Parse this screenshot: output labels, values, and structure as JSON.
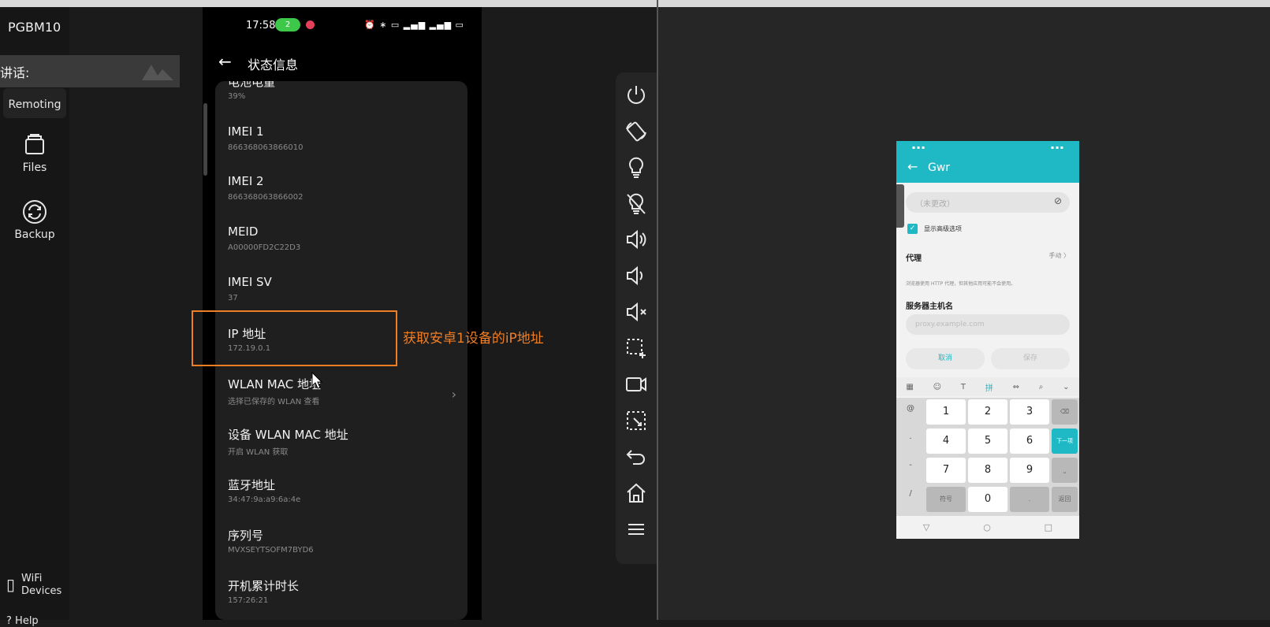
{
  "sidebar": {
    "app_title": "PGBM10",
    "talk_label": "讲话:",
    "items": [
      {
        "label": "Remoting"
      },
      {
        "label": "Files"
      },
      {
        "label": "Backup"
      }
    ],
    "wifi_label_1": "WiFi",
    "wifi_label_2": "Devices",
    "help_label": "Help"
  },
  "phone": {
    "status_time": "17:58",
    "status_pill": "2",
    "page_title": "状态信息",
    "rows": [
      {
        "title": "电池电量",
        "value": "39%"
      },
      {
        "title": "IMEI 1",
        "value": "866368063866010"
      },
      {
        "title": "IMEI 2",
        "value": "866368063866002"
      },
      {
        "title": "MEID",
        "value": "A00000FD2C22D3"
      },
      {
        "title": "IMEI SV",
        "value": "37"
      },
      {
        "title": "IP 地址",
        "value": "172.19.0.1"
      },
      {
        "title": "WLAN MAC 地址",
        "value": "选择已保存的 WLAN 查看"
      },
      {
        "title": "设备 WLAN MAC 地址",
        "value": "开启 WLAN 获取"
      },
      {
        "title": "蓝牙地址",
        "value": "34:47:9a:a9:6a:4e"
      },
      {
        "title": "序列号",
        "value": "MVXSEYTSOFM7BYD6"
      },
      {
        "title": "开机累计时长",
        "value": "157:26:21"
      }
    ]
  },
  "annotation": {
    "text": "获取安卓1设备的iP地址",
    "color": "#f07e25"
  },
  "controls": [
    {
      "icon": "power-icon"
    },
    {
      "icon": "rotate-icon"
    },
    {
      "icon": "light-bulb-icon"
    },
    {
      "icon": "light-off-icon"
    },
    {
      "icon": "volume-up-icon"
    },
    {
      "icon": "volume-down-icon"
    },
    {
      "icon": "volume-mute-icon"
    },
    {
      "icon": "screenshot-icon"
    },
    {
      "icon": "record-icon"
    },
    {
      "icon": "crop-icon"
    },
    {
      "icon": "back-icon"
    },
    {
      "icon": "home-icon"
    },
    {
      "icon": "menu-icon"
    }
  ],
  "mini_phone": {
    "title": "Gwr",
    "password_placeholder": "（未更改）",
    "show_advanced": "显示高级选项",
    "proxy_label": "代理",
    "proxy_value": "手动 〉",
    "proxy_hint": "浏览器使用 HTTP 代理，但其他应用可能不会使用。",
    "host_label": "服务器主机名",
    "host_placeholder": "proxy.example.com",
    "cancel": "取消",
    "save": "保存",
    "keys": [
      "1",
      "2",
      "3",
      "4",
      "5",
      "6",
      "7",
      "8",
      "9",
      "0"
    ],
    "key_symbol": "符号",
    "key_next": "下一项",
    "key_return": "返回",
    "accent": "#1fb9c5"
  }
}
